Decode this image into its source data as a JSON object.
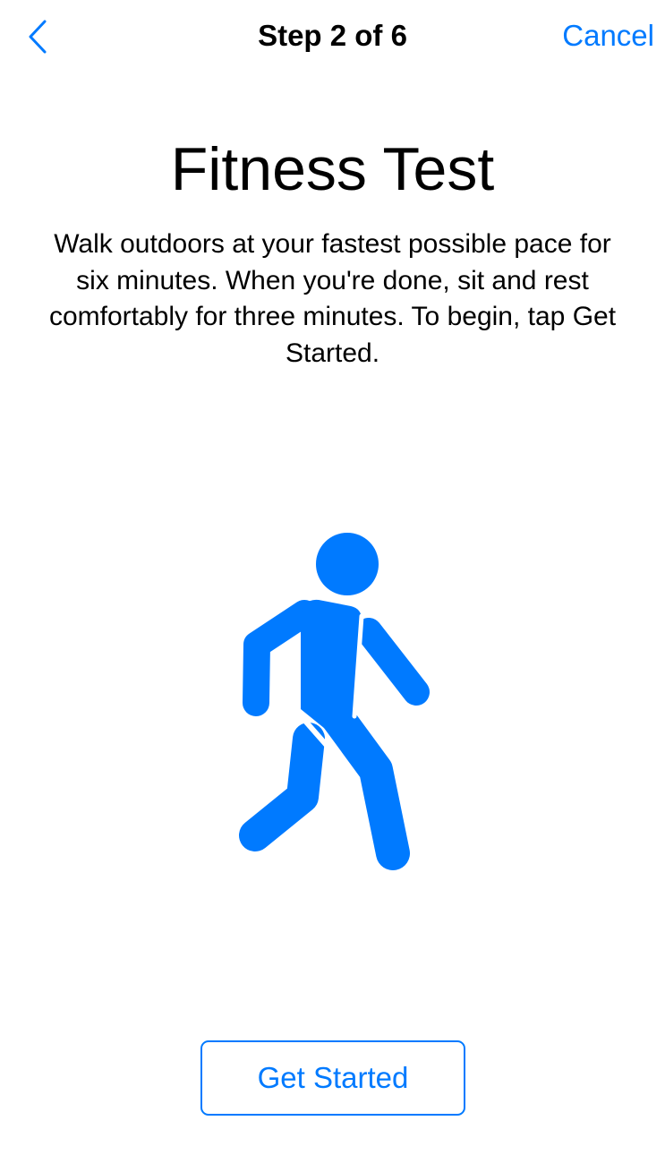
{
  "nav": {
    "back_icon": "chevron-left-icon",
    "title": "Step 2 of 6",
    "cancel_label": "Cancel"
  },
  "content": {
    "title": "Fitness Test",
    "instructions": "Walk outdoors at your fastest possible pace for six minutes. When you're done, sit and rest comfortably for three minutes. To begin, tap Get Started.",
    "illustration_icon": "walking-person-icon"
  },
  "footer": {
    "get_started_label": "Get Started"
  },
  "colors": {
    "accent": "#007aff",
    "text": "#000000",
    "background": "#ffffff"
  }
}
